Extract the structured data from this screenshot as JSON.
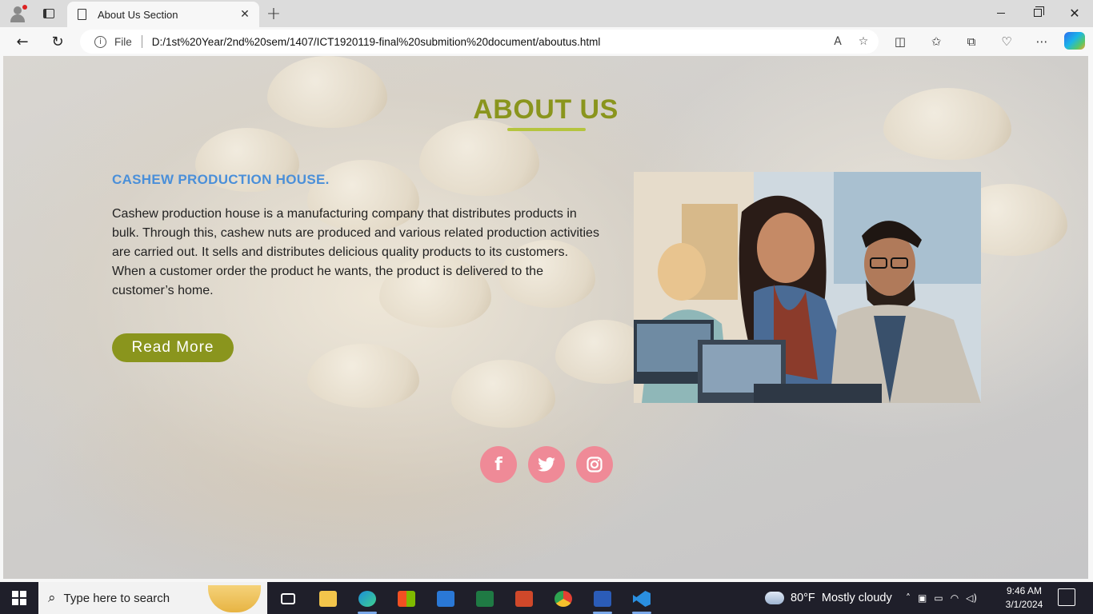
{
  "browser": {
    "tab_title": "About Us Section",
    "new_tab_glyph": "+",
    "tab_close_glyph": "✕",
    "address_scheme_label": "File",
    "url": "D:/1st%20Year/2nd%20sem/1407/ICT1920119-final%20submition%20document/aboutus.html",
    "icons": [
      "profile-icon",
      "workspaces-icon",
      "page-icon",
      "back-icon",
      "reload-icon",
      "info-icon",
      "read-aloud-icon",
      "favorite-star-icon",
      "split-screen-icon",
      "favorites-icon",
      "collections-icon",
      "performance-icon",
      "more-icon",
      "copilot-icon"
    ]
  },
  "page": {
    "heading": "ABOUT US",
    "subheading": "CASHEW PRODUCTION HOUSE.",
    "description": "Cashew production house is a manufacturing company that distributes products in bulk. Through this, cashew nuts are produced and various related production activities are carried out. It sells and distributes delicious quality products to its customers. When a customer order the product he wants, the product is delivered to the customer’s home.",
    "read_more_label": "Read More",
    "social": [
      {
        "name": "facebook",
        "glyph": "f"
      },
      {
        "name": "twitter",
        "glyph": "🐦"
      },
      {
        "name": "instagram",
        "glyph": "◎"
      }
    ],
    "colors": {
      "heading": "#8a951d",
      "subheading": "#4a8fd9",
      "button": "#8a951d",
      "social": "#ef8a97"
    }
  },
  "taskbar": {
    "search_placeholder": "Type here to search",
    "weather_temp": "80°F",
    "weather_text": "Mostly cloudy",
    "time": "9:46 AM",
    "date": "3/1/2024",
    "apps": [
      "task-view",
      "file-explorer",
      "edge",
      "microsoft-store",
      "mail",
      "excel",
      "powerpoint",
      "chrome",
      "word",
      "vscode"
    ]
  }
}
